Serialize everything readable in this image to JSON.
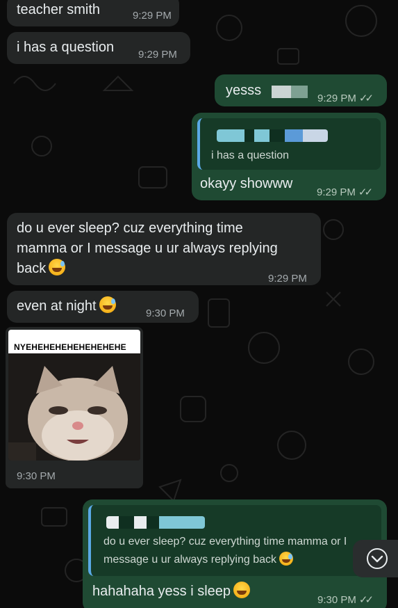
{
  "messages": {
    "m1": {
      "text": "teacher smith",
      "time": "9:29 PM"
    },
    "m2": {
      "text": "i has a question",
      "time": "9:29 PM"
    },
    "m3": {
      "text": "yesss",
      "time": "9:29 PM"
    },
    "m4": {
      "quote": "i has a question",
      "text": "okayy showww",
      "time": "9:29 PM"
    },
    "m5": {
      "line1": "do u ever sleep? cuz everything time",
      "line2": "mamma or I message u ur always replying",
      "line3": "back",
      "time": "9:29 PM"
    },
    "m6": {
      "text": "even at night",
      "time": "9:30 PM"
    },
    "m7": {
      "caption": "NYEHEHEHEHEHEHEHEHE",
      "time": "9:30 PM"
    },
    "m8": {
      "quote_line1": "do u ever sleep? cuz everything time mamma or I",
      "quote_line2": "message u ur always replying back",
      "text": "hahahaha yess i sleep",
      "time": "9:30 PM"
    }
  },
  "colors": {
    "incoming_bubble": "#242626",
    "outgoing_bubble": "#1f4a33",
    "quote_bar": "#5aa9e6",
    "background": "#0b0b0b"
  },
  "icons": {
    "read_receipt": "double-check-icon",
    "scroll_down": "chevron-down-icon"
  }
}
